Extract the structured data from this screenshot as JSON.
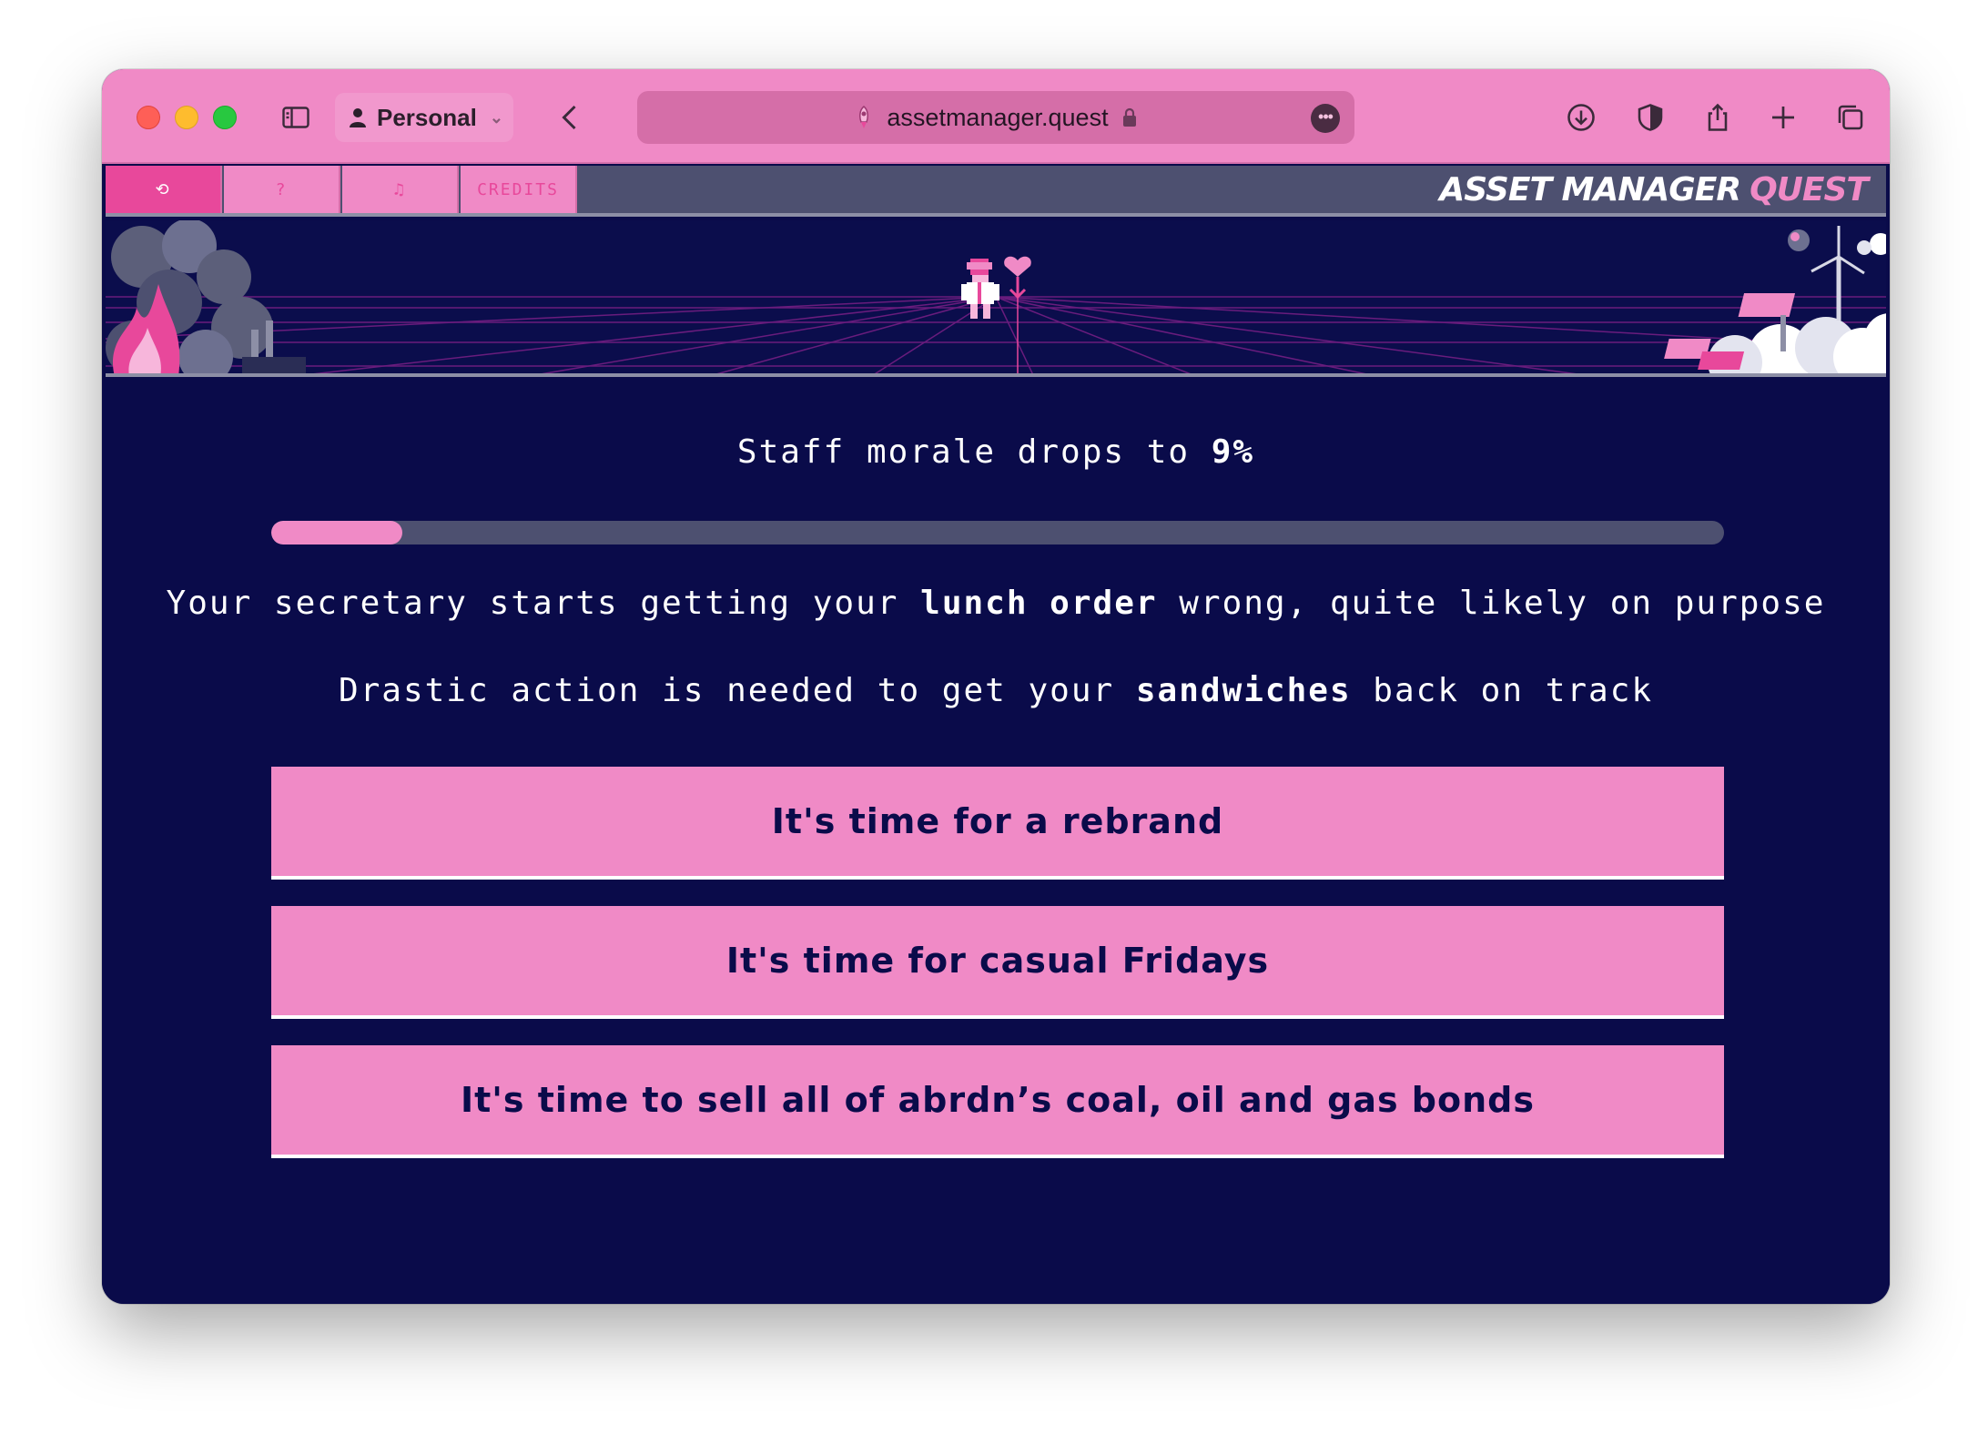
{
  "browser": {
    "profile_label": "Personal",
    "url": "assetmanager.quest",
    "icons": [
      "sidebar-icon",
      "person-icon",
      "back-icon",
      "rocket-icon",
      "lock-icon",
      "more-icon",
      "download-icon",
      "shield-icon",
      "share-icon",
      "plus-icon",
      "tabs-icon"
    ]
  },
  "game_bar": {
    "tabs": [
      {
        "label": "⟲",
        "icon": "restart-icon"
      },
      {
        "label": "?",
        "icon": "help-icon"
      },
      {
        "label": "♫",
        "icon": "music-icon"
      },
      {
        "label": "CREDITS"
      }
    ],
    "logo_main": "ASSET MANAGER",
    "logo_accent": "QUEST"
  },
  "status": {
    "headline_prefix": "Staff morale drops to ",
    "headline_value": "9%",
    "morale_fraction": 0.09
  },
  "story": {
    "line1_a": "Your secretary starts getting your ",
    "line1_b": "lunch order",
    "line1_c": " wrong, quite likely on purpose",
    "line2_a": "Drastic action is needed to get your ",
    "line2_b": "sandwiches",
    "line2_c": " back on track"
  },
  "choices": [
    {
      "label": "It's time for a rebrand"
    },
    {
      "label": "It's time for casual Fridays"
    },
    {
      "label": "It's time to sell all of abrdn’s coal, oil and gas bonds"
    }
  ],
  "colors": {
    "pink": "#f08ac6",
    "hot_pink": "#e8489b",
    "navy": "#0a0b4a",
    "slate": "#4d5070"
  }
}
